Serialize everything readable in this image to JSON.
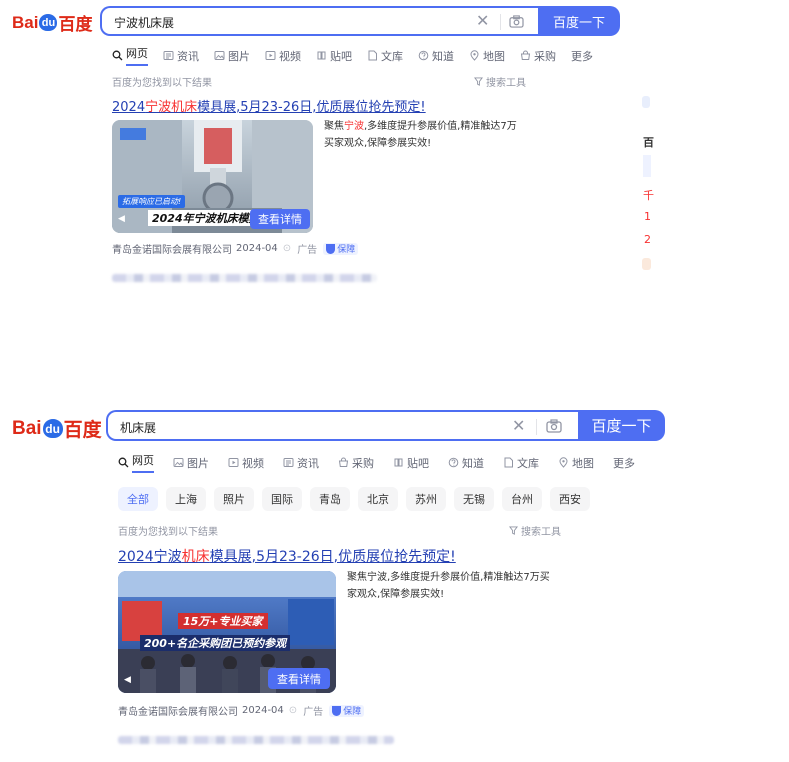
{
  "logo": {
    "bai": "Bai",
    "du": "du",
    "cn": "百度"
  },
  "shot1": {
    "query": "宁波机床展",
    "search_button": "百度一下",
    "tabs": [
      {
        "label": "网页",
        "icon": "search-icon",
        "active": true
      },
      {
        "label": "资讯",
        "icon": "news-icon"
      },
      {
        "label": "图片",
        "icon": "image-icon"
      },
      {
        "label": "视频",
        "icon": "video-icon"
      },
      {
        "label": "贴吧",
        "icon": "tieba-icon"
      },
      {
        "label": "文库",
        "icon": "doc-icon"
      },
      {
        "label": "知道",
        "icon": "question-icon"
      },
      {
        "label": "地图",
        "icon": "map-icon"
      },
      {
        "label": "采购",
        "icon": "shop-icon"
      },
      {
        "label": "更多"
      }
    ],
    "result_count": "百度为您找到以下结果",
    "search_tools": "搜索工具",
    "result": {
      "title_pre": "2024",
      "title_em": "宁波机床",
      "title_post": "模具展,5月23-26日,优质展位抢先预定!",
      "desc_pre": "聚焦",
      "desc_em": "宁波",
      "desc_post": ",多维度提升参展价值,精准触达7万买家观众,保障参展实效!",
      "thumb_banner": "拓展响应已启动!",
      "thumb_caption": "2024年宁波机床模具",
      "detail_button": "查看详情",
      "source": "青岛金诺国际会展有限公司",
      "date": "2024-04",
      "ad": "广告",
      "badge": "保障"
    },
    "edge_texts": [
      "百",
      "千",
      "1",
      "2"
    ]
  },
  "shot2": {
    "query": "机床展",
    "search_button": "百度一下",
    "tabs": [
      {
        "label": "网页",
        "icon": "search-icon",
        "active": true
      },
      {
        "label": "图片",
        "icon": "image-icon"
      },
      {
        "label": "视频",
        "icon": "video-icon"
      },
      {
        "label": "资讯",
        "icon": "news-icon"
      },
      {
        "label": "采购",
        "icon": "shop-icon"
      },
      {
        "label": "贴吧",
        "icon": "tieba-icon"
      },
      {
        "label": "知道",
        "icon": "question-icon"
      },
      {
        "label": "文库",
        "icon": "doc-icon"
      },
      {
        "label": "地图",
        "icon": "map-icon"
      },
      {
        "label": "更多"
      }
    ],
    "chips": [
      "全部",
      "上海",
      "照片",
      "国际",
      "青岛",
      "北京",
      "苏州",
      "无锡",
      "台州",
      "西安"
    ],
    "result_count": "百度为您找到以下结果",
    "search_tools": "搜索工具",
    "result": {
      "title_pre": "2024宁波",
      "title_em": "机床",
      "title_post": "模具展,5月23-26日,优质展位抢先预定!",
      "desc": "聚焦宁波,多维度提升参展价值,精准触达7万买家观众,保障参展实效!",
      "thumb_line1": "15万+专业买家",
      "thumb_line2": "200+名企采购团已预约参观",
      "detail_button": "查看详情",
      "source": "青岛金诺国际会展有限公司",
      "date": "2024-04",
      "ad": "广告",
      "badge": "保障"
    }
  },
  "colors": {
    "brand_blue": "#4e6ef2",
    "link": "#2440b3",
    "highlight": "#f73131",
    "logo_red": "#de2a18"
  }
}
